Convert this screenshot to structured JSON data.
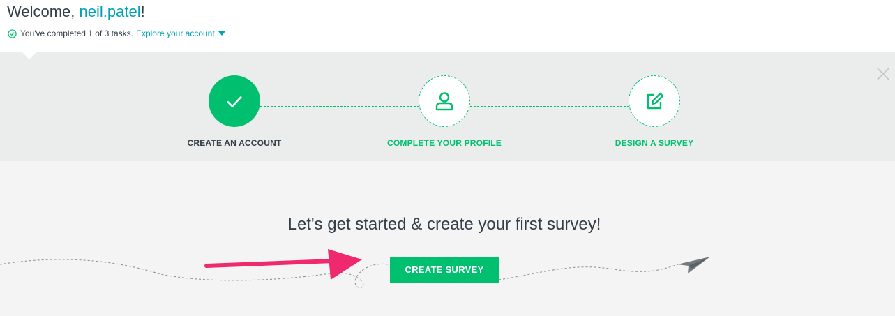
{
  "header": {
    "welcome_prefix": "Welcome, ",
    "username": "neil.patel",
    "welcome_suffix": "!",
    "progress_text": "You've completed 1 of 3 tasks.",
    "explore_link": "Explore your account"
  },
  "steps": [
    {
      "label": "CREATE AN ACCOUNT",
      "status": "completed",
      "icon": "checkmark-icon"
    },
    {
      "label": "COMPLETE YOUR PROFILE",
      "status": "pending",
      "icon": "user-profile-icon"
    },
    {
      "label": "DESIGN A SURVEY",
      "status": "pending",
      "icon": "edit-icon"
    }
  ],
  "cta": {
    "heading": "Let's get started & create your first survey!",
    "button_label": "CREATE SURVEY"
  },
  "colors": {
    "brand_green": "#00bf6f",
    "link_teal": "#00a2b5",
    "annotation_arrow": "#f0286e",
    "band_gray": "#ebedec",
    "cta_bg": "#f4f4f4"
  }
}
